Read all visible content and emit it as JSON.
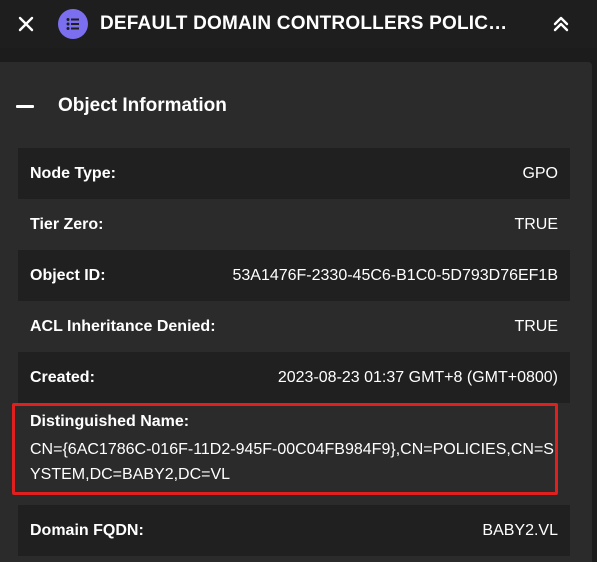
{
  "header": {
    "title": "DEFAULT DOMAIN CONTROLLERS POLIC…",
    "close_icon": "close-icon",
    "node_icon": "list-icon",
    "collapse_icon": "double-chevron-up-icon",
    "accent_color": "#7b6ff0"
  },
  "section": {
    "title": "Object Information",
    "toggle_icon": "minus-icon"
  },
  "rows": [
    {
      "label": "Node Type:",
      "value": "GPO"
    },
    {
      "label": "Tier Zero:",
      "value": "TRUE"
    },
    {
      "label": "Object ID:",
      "value": "53A1476F-2330-45C6-B1C0-5D793D76EF1B"
    },
    {
      "label": "ACL Inheritance Denied:",
      "value": "TRUE"
    },
    {
      "label": "Created:",
      "value": "2023-08-23 01:37 GMT+8 (GMT+0800)"
    }
  ],
  "distinguished_name": {
    "label": "Distinguished Name:",
    "value": "CN={6AC1786C-016F-11D2-945F-00C04FB984F9},CN=POLICIES,CN=SYSTEM,DC=BABY2,DC=VL",
    "highlight_color": "#e0201e"
  },
  "domain_fqdn": {
    "label": "Domain FQDN:",
    "value": "BABY2.VL"
  }
}
